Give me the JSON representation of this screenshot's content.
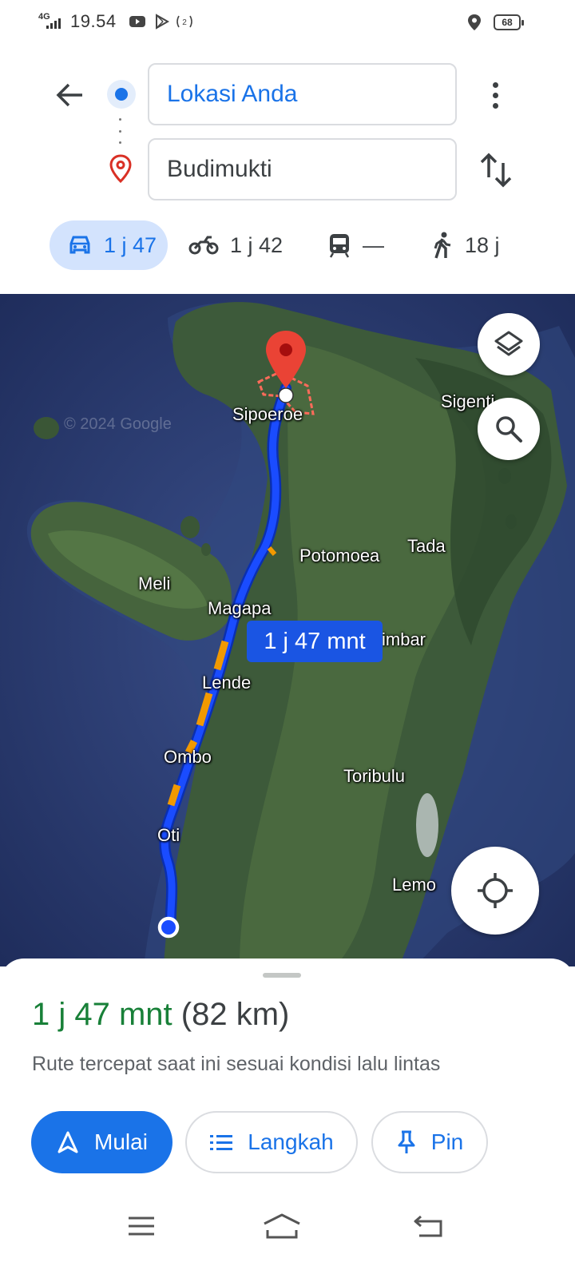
{
  "status_bar": {
    "network": "4G",
    "time": "19.54",
    "battery": "68"
  },
  "directions": {
    "origin": "Lokasi Anda",
    "destination": "Budimukti"
  },
  "modes": [
    {
      "name": "car",
      "time": "1 j 47",
      "selected": true
    },
    {
      "name": "motorcycle",
      "time": "1 j 42",
      "selected": false
    },
    {
      "name": "transit",
      "time": "—",
      "selected": false
    },
    {
      "name": "walk",
      "time": "18 j",
      "selected": false
    }
  ],
  "map": {
    "watermark": "© 2024 Google",
    "route_label": "1 j 47 mnt",
    "places": {
      "sipoeroe": "Sipoeroe",
      "sigenti": "Sigenti",
      "potomoea": "Potomoea",
      "tada": "Tada",
      "meli": "Meli",
      "magapa": "Magapa",
      "timbar": "imbar",
      "lende": "Lende",
      "ombo": "Ombo",
      "toribulu": "Toribulu",
      "oti": "Oti",
      "lemo": "Lemo"
    }
  },
  "sheet": {
    "duration": "1 j 47 mnt",
    "distance": "(82 km)",
    "description": "Rute tercepat saat ini sesuai kondisi lalu lintas",
    "start_label": "Mulai",
    "steps_label": "Langkah",
    "pin_label": "Pin"
  },
  "colors": {
    "accent": "#1a73e8",
    "duration": "#188038",
    "route": "#1a4cff",
    "traffic": "#f29900",
    "pin": "#ea4335"
  }
}
